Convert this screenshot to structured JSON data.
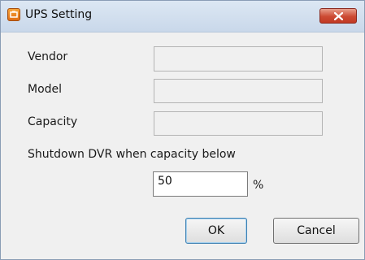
{
  "window": {
    "title": "UPS Setting"
  },
  "icons": {
    "app": "ups-app-icon",
    "close": "close-icon"
  },
  "fields": {
    "vendor_label": "Vendor",
    "vendor_value": "",
    "model_label": "Model",
    "model_value": "",
    "capacity_label": "Capacity",
    "capacity_value": ""
  },
  "shutdown": {
    "label": "Shutdown DVR when capacity below",
    "value": "50",
    "unit": "%"
  },
  "buttons": {
    "ok": "OK",
    "cancel": "Cancel"
  },
  "colors": {
    "titlebar": "#c9d8ea",
    "close_button": "#cc4a33",
    "dialog_background": "#f0f0f0"
  }
}
